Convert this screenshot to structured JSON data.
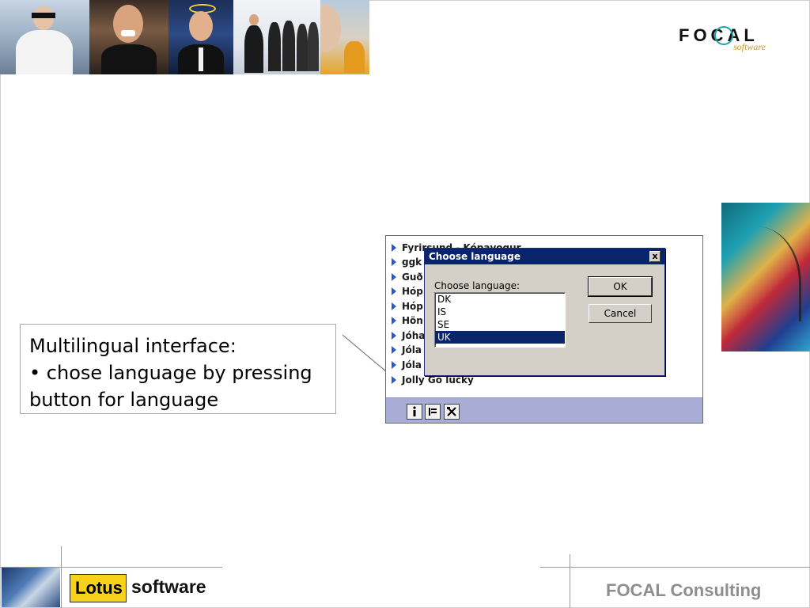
{
  "header": {
    "logo_text": "FOCAL",
    "logo_sub": "software"
  },
  "callout": {
    "line1": "Multilingual interface:",
    "line2": "• chose language by pressing",
    "line3": "button for language"
  },
  "app": {
    "rows": [
      {
        "label": "Fyrirsund - Kópavogur"
      },
      {
        "label": "ggk"
      },
      {
        "label": "Guð"
      },
      {
        "label": "Hóp"
      },
      {
        "label": "Hóp"
      },
      {
        "label": "Hön"
      },
      {
        "label": "Jóha"
      },
      {
        "label": "Jóla"
      },
      {
        "label": "Jóla"
      },
      {
        "label": "Jolly Go lucky"
      }
    ],
    "toolbar_icons": [
      "info-icon",
      "flag-icon",
      "tools-icon"
    ]
  },
  "dialog": {
    "title": "Choose language",
    "close": "x",
    "label": "Choose language:",
    "options": [
      "DK",
      "IS",
      "SE",
      "UK"
    ],
    "selected": "UK",
    "ok_label": "OK",
    "cancel_label": "Cancel"
  },
  "footer": {
    "lotus": "Lotus",
    "software": "software",
    "consulting": "FOCAL Consulting"
  }
}
